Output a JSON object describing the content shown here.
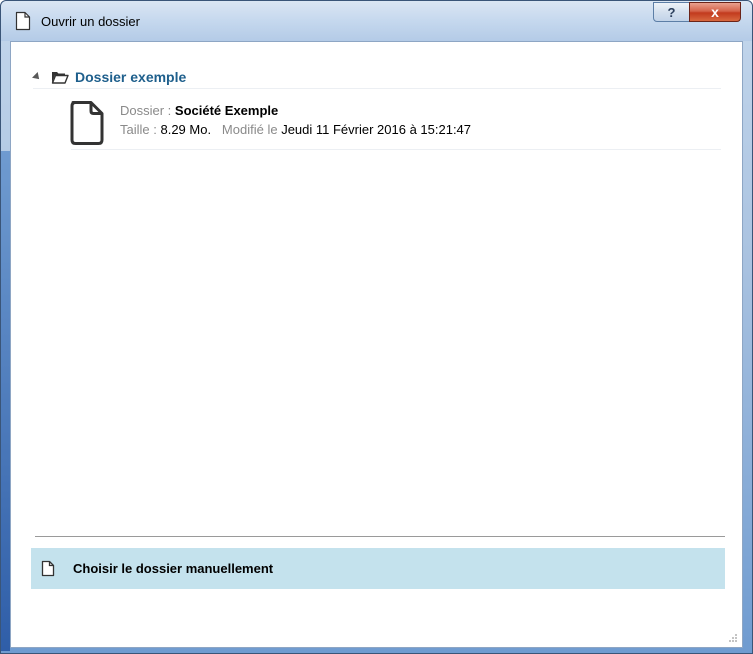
{
  "window": {
    "title": "Ouvrir un dossier",
    "help_label": "?",
    "close_label": "x"
  },
  "group": {
    "title": "Dossier exemple"
  },
  "item": {
    "dossier_label": "Dossier :",
    "dossier_value": "Société Exemple",
    "taille_label": "Taille :",
    "taille_value": "8.29 Mo.",
    "modifie_label": "Modifié le",
    "modifie_value": "Jeudi 11 Février 2016 à 15:21:47"
  },
  "actions": {
    "choose_manual": "Choisir le dossier manuellement"
  },
  "colors": {
    "group_title": "#1e5f8c",
    "choose_bg": "#c4e2ed",
    "close_button": "#c23a1e"
  }
}
